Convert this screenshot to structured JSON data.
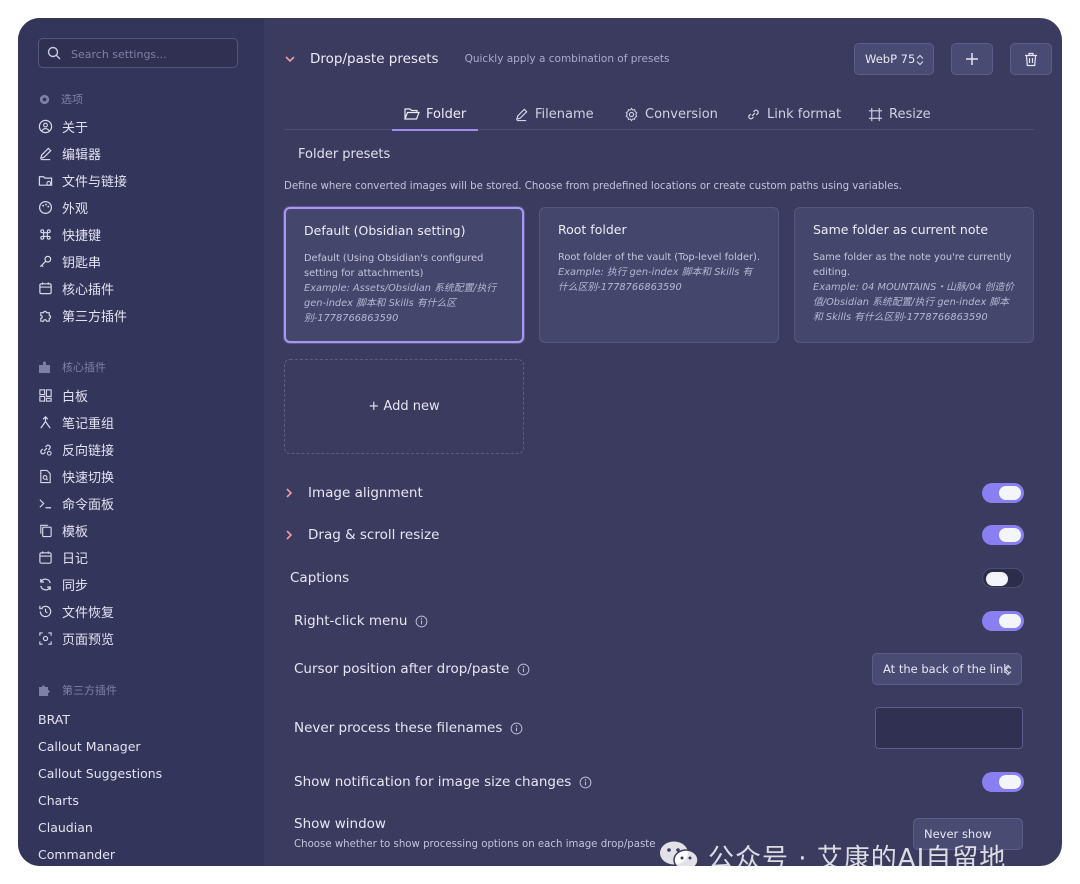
{
  "search": {
    "placeholder": "Search settings..."
  },
  "sidebar": {
    "options_header": "选项",
    "options_items": [
      {
        "label": "关于",
        "icon": "user-circle-icon"
      },
      {
        "label": "编辑器",
        "icon": "pencil-icon"
      },
      {
        "label": "文件与链接",
        "icon": "folder-link-icon"
      },
      {
        "label": "外观",
        "icon": "palette-icon"
      },
      {
        "label": "快捷键",
        "icon": "command-icon"
      },
      {
        "label": "钥匙串",
        "icon": "key-icon"
      },
      {
        "label": "核心插件",
        "icon": "calendar-box-icon"
      },
      {
        "label": "第三方插件",
        "icon": "puzzle-icon"
      }
    ],
    "core_header": "核心插件",
    "core_items": [
      {
        "label": "白板",
        "icon": "grid-icon"
      },
      {
        "label": "笔记重组",
        "icon": "merge-icon"
      },
      {
        "label": "反向链接",
        "icon": "backlink-icon"
      },
      {
        "label": "快速切换",
        "icon": "file-search-icon"
      },
      {
        "label": "命令面板",
        "icon": "terminal-icon"
      },
      {
        "label": "模板",
        "icon": "copy-icon"
      },
      {
        "label": "日记",
        "icon": "calendar-icon"
      },
      {
        "label": "同步",
        "icon": "refresh-icon"
      },
      {
        "label": "文件恢复",
        "icon": "history-icon"
      },
      {
        "label": "页面预览",
        "icon": "preview-icon"
      }
    ],
    "third_header": "第三方插件",
    "third_items": [
      "BRAT",
      "Callout Manager",
      "Callout Suggestions",
      "Charts",
      "Claudian",
      "Commander"
    ]
  },
  "presets": {
    "title": "Drop/paste presets",
    "subtitle": "Quickly apply a combination of presets",
    "format_value": "WebP 75"
  },
  "tabs": [
    "Folder",
    "Filename",
    "Conversion",
    "Link format",
    "Resize"
  ],
  "folder": {
    "label": "Folder presets",
    "description": "Define where converted images will be stored. Choose from predefined locations or create custom paths using variables.",
    "cards": [
      {
        "title": "Default (Obsidian setting)",
        "desc": "Default (Using Obsidian's configured setting for attachments)",
        "example": "Example: Assets/Obsidian 系统配置/执行 gen-index 脚本和 Skills 有什么区别-1778766863590"
      },
      {
        "title": "Root folder",
        "desc": "Root folder of the vault (Top-level folder).",
        "example": "Example: 执行 gen-index 脚本和 Skills 有什么区别-1778766863590"
      },
      {
        "title": "Same folder as current note",
        "desc": "Same folder as the note you're currently editing.",
        "example": "Example: 04 MOUNTAINS・山脉/04 创造价值/Obsidian 系统配置/执行 gen-index 脚本和 Skills 有什么区别-1778766863590"
      }
    ],
    "add_new": "+ Add new"
  },
  "settings": {
    "image_alignment": "Image alignment",
    "drag_scroll_resize": "Drag & scroll resize",
    "captions": "Captions",
    "right_click_menu": "Right-click menu",
    "cursor_position": "Cursor position after drop/paste",
    "cursor_position_value": "At the back of the link",
    "never_process": "Never process these filenames",
    "show_notification": "Show notification for image size changes",
    "show_window": "Show window",
    "show_window_desc": "Choose whether to show processing options on each image drop/paste",
    "show_window_value": "Never show"
  },
  "toggles": {
    "image_alignment": true,
    "drag_scroll_resize": true,
    "captions": false,
    "right_click_menu": true,
    "show_notification": true
  },
  "watermark": {
    "text": "公众号 · 艾康的AI自留地",
    "icon": "wechat-icon"
  },
  "colors": {
    "accent": "#8a7ff0",
    "background": "#3b3b5f",
    "sidebar": "#34355a"
  }
}
